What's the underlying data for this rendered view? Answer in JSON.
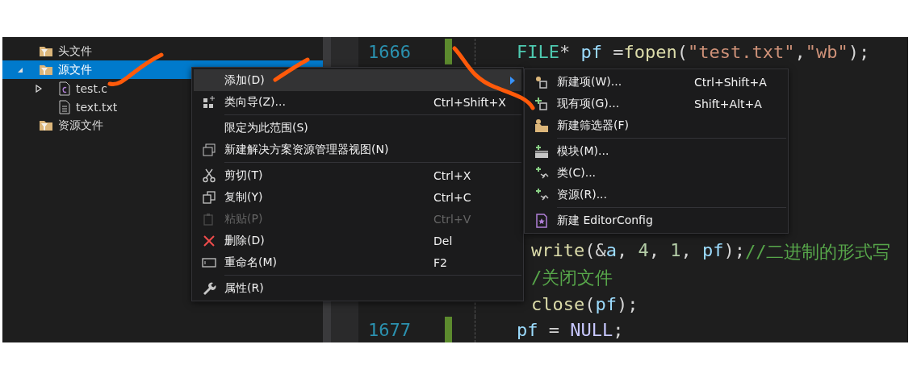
{
  "solution_explorer": {
    "items": [
      {
        "label": "头文件",
        "selected": false
      },
      {
        "label": "源文件",
        "selected": true,
        "expanded": true,
        "children": [
          {
            "label": "test.c",
            "selected": false,
            "expanded": false
          },
          {
            "label": "text.txt",
            "selected": false
          }
        ]
      },
      {
        "label": "资源文件",
        "selected": false
      }
    ]
  },
  "editor": {
    "lines": [
      {
        "number": "1666",
        "tokens": [
          {
            "kind": "type",
            "text": "FILE"
          },
          {
            "kind": "plain",
            "text": "* "
          },
          {
            "kind": "var",
            "text": "pf"
          },
          {
            "kind": "plain",
            "text": " ="
          },
          {
            "kind": "func",
            "text": "fopen"
          },
          {
            "kind": "plain",
            "text": "("
          },
          {
            "kind": "string",
            "text": "\"test.txt\""
          },
          {
            "kind": "plain",
            "text": ","
          },
          {
            "kind": "string",
            "text": "\"wb\""
          },
          {
            "kind": "plain",
            "text": ");"
          }
        ]
      },
      {
        "tokens": [
          {
            "kind": "func",
            "text": "write"
          },
          {
            "kind": "plain",
            "text": "(&"
          },
          {
            "kind": "var",
            "text": "a"
          },
          {
            "kind": "plain",
            "text": ", "
          },
          {
            "kind": "number",
            "text": "4"
          },
          {
            "kind": "plain",
            "text": ", "
          },
          {
            "kind": "number",
            "text": "1"
          },
          {
            "kind": "plain",
            "text": ", "
          },
          {
            "kind": "var",
            "text": "pf"
          },
          {
            "kind": "plain",
            "text": ");"
          },
          {
            "kind": "comment",
            "text": "//二进制的形式写"
          }
        ]
      },
      {
        "tokens": [
          {
            "kind": "comment",
            "text": "/关闭文件"
          }
        ]
      },
      {
        "tokens": [
          {
            "kind": "func",
            "text": "close"
          },
          {
            "kind": "plain",
            "text": "("
          },
          {
            "kind": "var",
            "text": "pf"
          },
          {
            "kind": "plain",
            "text": ");"
          }
        ]
      },
      {
        "number": "1677",
        "tokens": [
          {
            "kind": "var",
            "text": "pf"
          },
          {
            "kind": "plain",
            "text": " = "
          },
          {
            "kind": "macro",
            "text": "NULL"
          },
          {
            "kind": "plain",
            "text": ";"
          }
        ]
      }
    ]
  },
  "context_menu": {
    "items": [
      {
        "kind": "item",
        "label": "添加(D)",
        "highlighted": true,
        "submenu": true
      },
      {
        "kind": "item",
        "label": "类向导(Z)...",
        "shortcut": "Ctrl+Shift+X"
      },
      {
        "kind": "separator"
      },
      {
        "kind": "item",
        "label": "限定为此范围(S)"
      },
      {
        "kind": "item",
        "label": "新建解决方案资源管理器视图(N)"
      },
      {
        "kind": "separator"
      },
      {
        "kind": "item",
        "label": "剪切(T)",
        "shortcut": "Ctrl+X"
      },
      {
        "kind": "item",
        "label": "复制(Y)",
        "shortcut": "Ctrl+C"
      },
      {
        "kind": "item",
        "label": "粘贴(P)",
        "shortcut": "Ctrl+V",
        "disabled": true
      },
      {
        "kind": "item",
        "label": "删除(D)",
        "shortcut": "Del"
      },
      {
        "kind": "item",
        "label": "重命名(M)",
        "shortcut": "F2"
      },
      {
        "kind": "separator"
      },
      {
        "kind": "item",
        "label": "属性(R)"
      }
    ]
  },
  "submenu": {
    "items": [
      {
        "kind": "item",
        "label": "新建项(W)...",
        "shortcut": "Ctrl+Shift+A"
      },
      {
        "kind": "item",
        "label": "现有项(G)...",
        "shortcut": "Shift+Alt+A"
      },
      {
        "kind": "item",
        "label": "新建筛选器(F)"
      },
      {
        "kind": "separator"
      },
      {
        "kind": "item",
        "label": "模块(M)..."
      },
      {
        "kind": "item",
        "label": "类(C)..."
      },
      {
        "kind": "item",
        "label": "资源(R)..."
      },
      {
        "kind": "separator"
      },
      {
        "kind": "item",
        "label": "新建 EditorConfig"
      }
    ]
  }
}
